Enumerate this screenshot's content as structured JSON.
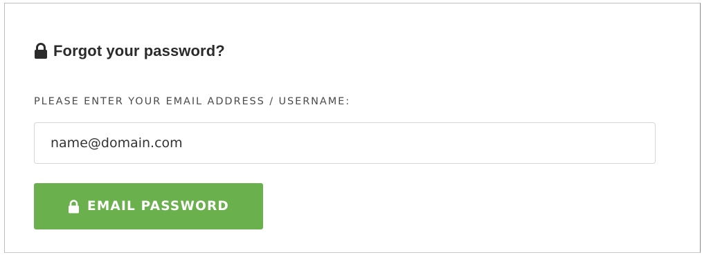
{
  "form": {
    "title": "Forgot your password?",
    "title_icon": "lock-icon",
    "field_label": "PLEASE ENTER YOUR EMAIL ADDRESS / USERNAME:",
    "email_value": "name@domain.com",
    "submit_label": "EMAIL PASSWORD",
    "submit_icon": "lock-icon"
  },
  "colors": {
    "button_bg": "#6ab04c",
    "title_text": "#2b2b2b",
    "label_text": "#4a4a4a"
  }
}
